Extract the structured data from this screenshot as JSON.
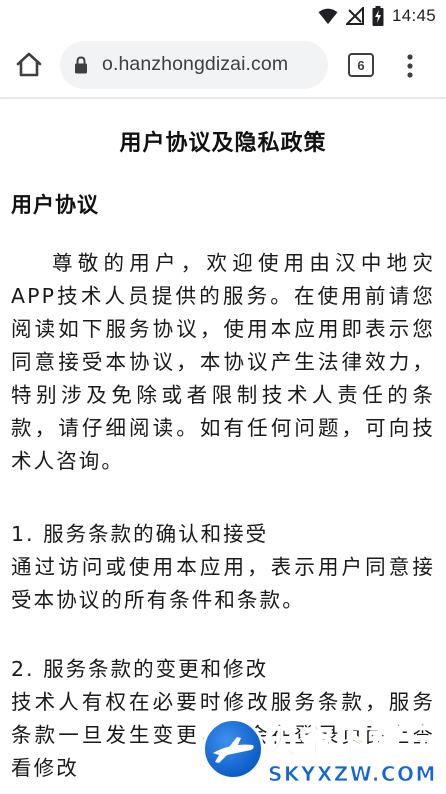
{
  "status_bar": {
    "time": "14:45"
  },
  "browser": {
    "url": "o.hanzhongdizai.com",
    "tab_count": "6"
  },
  "page": {
    "title": "用户协议及隐私政策",
    "section_heading": "用户协议",
    "intro": "尊敬的用户，欢迎使用由汉中地灾APP技术人员提供的服务。在使用前请您阅读如下服务协议，使用本应用即表示您同意接受本协议，本协议产生法律效力，特别涉及免除或者限制技术人责任的条款，请仔细阅读。如有任何问题，可向技术人咨询。",
    "items": [
      {
        "heading": "1. 服务条款的确认和接受",
        "body": "通过访问或使用本应用，表示用户同意接受本协议的所有条件和条款。"
      },
      {
        "heading": "2. 服务条款的变更和修改",
        "body": "技术人有权在必要时修改服务条款，服务条款一旦发生变更，将会在登录页面上查看修改"
      }
    ]
  },
  "watermark": {
    "title_main": "天空",
    "title_accent": "下载玩",
    "subtitle": "SKYXZW.COM"
  },
  "colors": {
    "watermark_blue": "#1466d3",
    "watermark_orange": "#f29310"
  }
}
